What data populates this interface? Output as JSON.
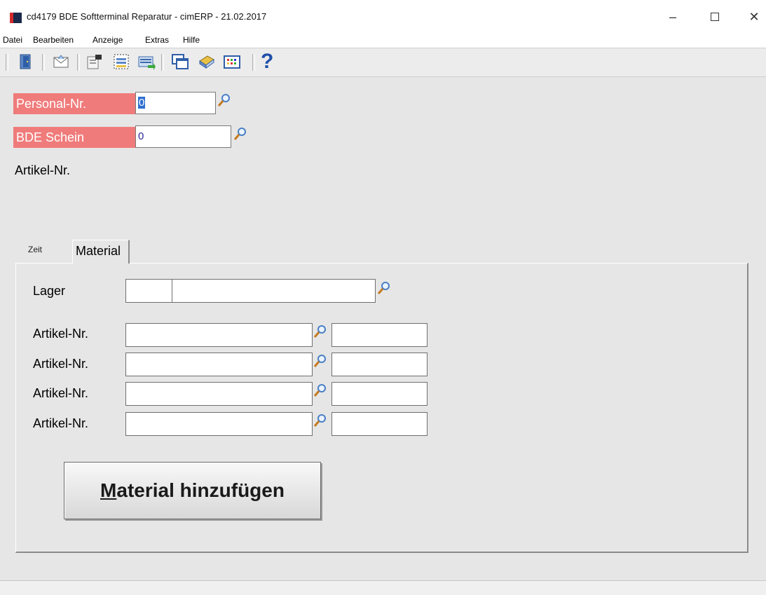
{
  "window": {
    "title": "cd4179 BDE Softterminal Reparatur - cimERP - 21.02.2017",
    "minimize_glyph": "–",
    "close_glyph": "✕"
  },
  "menu": [
    "Datei",
    "Bearbeiten",
    "Anzeige",
    "Extras",
    "Hilfe"
  ],
  "toolbar": {
    "icons": [
      "exit-door-icon",
      "envelope-icon",
      "edit-record-icon",
      "select-list-icon",
      "data-transfer-icon",
      "windows-icon",
      "book-icon",
      "grid-icon",
      "help-icon"
    ],
    "help_glyph": "?"
  },
  "form": {
    "personal_label": "Personal-Nr.",
    "personal_value": "0",
    "bde_label": "BDE Schein",
    "bde_value": "0",
    "artikel_label": "Artikel-Nr."
  },
  "tabs": {
    "zeit": "Zeit",
    "material": "Material"
  },
  "material": {
    "lager_label": "Lager",
    "lager_code": "",
    "lager_name": "",
    "rows": [
      {
        "label": "Artikel-Nr.",
        "value": "",
        "qty": ""
      },
      {
        "label": "Artikel-Nr.",
        "value": "",
        "qty": ""
      },
      {
        "label": "Artikel-Nr.",
        "value": "",
        "qty": ""
      },
      {
        "label": "Artikel-Nr.",
        "value": "",
        "qty": ""
      }
    ],
    "button_mnemonic": "M",
    "button_rest": "aterial hinzufügen"
  },
  "colors": {
    "required_label_bg": "#f07b7b",
    "selection": "#2f6fd1"
  }
}
